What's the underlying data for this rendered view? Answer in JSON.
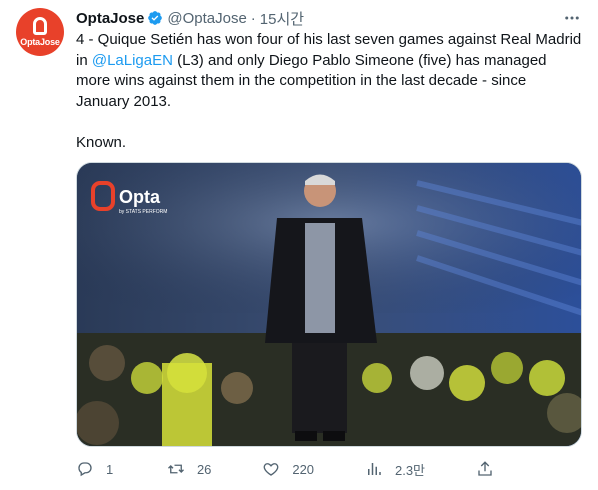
{
  "tweet": {
    "author": {
      "display_name": "OptaJose",
      "handle": "@OptaJose",
      "avatar_text": "OptaJose",
      "verified_icon": "verified-badge-icon"
    },
    "time": "15시간",
    "text_parts": [
      "4 - Quique Setién has won four of his last seven games against Real Madrid in ",
      "@LaLigaEN",
      " (L3) and only Diego Pablo Simeone (five) has managed more wins against them in the competition in the last decade - since January 2013.\n\nKnown."
    ],
    "media": {
      "watermark": "Opta",
      "watermark_sub": "by STATS PERFORM"
    },
    "actions": {
      "replies": "1",
      "retweets": "26",
      "likes": "220",
      "views": "2.3만"
    }
  },
  "colors": {
    "brand_red": "#e8412a",
    "link_blue": "#1d9bf0",
    "muted": "#536471"
  }
}
